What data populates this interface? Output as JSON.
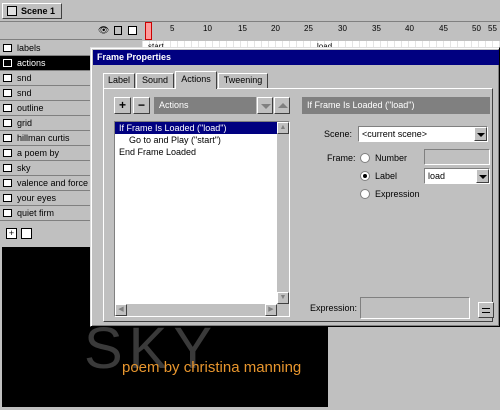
{
  "scene": {
    "tab_label": "Scene 1"
  },
  "timeline": {
    "ruler_ticks": [
      "5",
      "10",
      "15",
      "20",
      "25",
      "30",
      "35",
      "40",
      "45",
      "50",
      "55"
    ],
    "layers": [
      {
        "name": "labels",
        "selected": false
      },
      {
        "name": "actions",
        "selected": true
      },
      {
        "name": "snd",
        "selected": false
      },
      {
        "name": "snd",
        "selected": false
      },
      {
        "name": "outline",
        "selected": false
      },
      {
        "name": "grid",
        "selected": false
      },
      {
        "name": "hillman curtis",
        "selected": false
      },
      {
        "name": "a poem by",
        "selected": false
      },
      {
        "name": "sky",
        "selected": false
      },
      {
        "name": "valence and force",
        "selected": false
      },
      {
        "name": "your eyes",
        "selected": false
      },
      {
        "name": "quiet firm",
        "selected": false
      }
    ],
    "frame_labels": {
      "start": "start",
      "load": "load"
    }
  },
  "stage": {
    "ghost_text": "SKY",
    "caption": "poem by christina manning",
    "caption_color": "#e8962e"
  },
  "dialog": {
    "title": "Frame Properties",
    "tabs": [
      {
        "label": "Label",
        "active": false
      },
      {
        "label": "Sound",
        "active": false
      },
      {
        "label": "Actions",
        "active": true
      },
      {
        "label": "Tweening",
        "active": false
      }
    ],
    "actions_header": "Actions",
    "add_button": "+",
    "remove_button": "−",
    "script": [
      {
        "text": "If Frame Is Loaded (\"load\")",
        "selected": true,
        "indent": false
      },
      {
        "text": "Go to and Play (\"start\")",
        "selected": false,
        "indent": true
      },
      {
        "text": "End Frame Loaded",
        "selected": false,
        "indent": false
      }
    ],
    "props_header": "If Frame Is Loaded (\"load\")",
    "scene_label": "Scene:",
    "scene_value": "<current scene>",
    "frame_label": "Frame:",
    "frame_options": [
      {
        "label": "Number",
        "checked": false
      },
      {
        "label": "Label",
        "checked": true
      },
      {
        "label": "Expression",
        "checked": false
      }
    ],
    "label_value": "load",
    "expression_label": "Expression:"
  }
}
